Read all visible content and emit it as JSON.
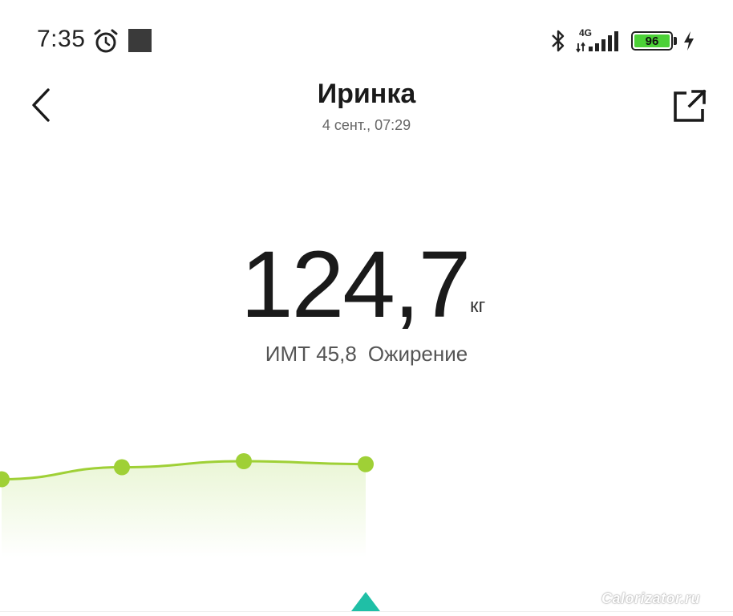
{
  "status_bar": {
    "time": "7:35",
    "network": "4G",
    "battery_level": "96",
    "icons": [
      "alarm-icon",
      "notification-square-icon",
      "bluetooth-icon",
      "signal-icon",
      "battery-icon",
      "charging-icon"
    ]
  },
  "header": {
    "title": "Иринка",
    "subtitle": "4 сент., 07:29",
    "back_icon": "chevron-left-icon",
    "share_icon": "share-external-icon"
  },
  "measurement": {
    "weight": "124,7",
    "unit": "кг",
    "bmi_label": "ИМТ 45,8",
    "bmi_category": "Ожирение"
  },
  "chart_data": {
    "type": "area",
    "series": [
      {
        "values": [
          124.2,
          124.6,
          124.8,
          124.7
        ]
      }
    ],
    "line_color": "#9fd036",
    "fill_color": "#eaf6d6"
  },
  "colors": {
    "accent_green": "#9fd036",
    "marker_teal": "#1fbfa6",
    "battery_green": "#4cd137"
  },
  "watermark": "Calorizator.ru"
}
